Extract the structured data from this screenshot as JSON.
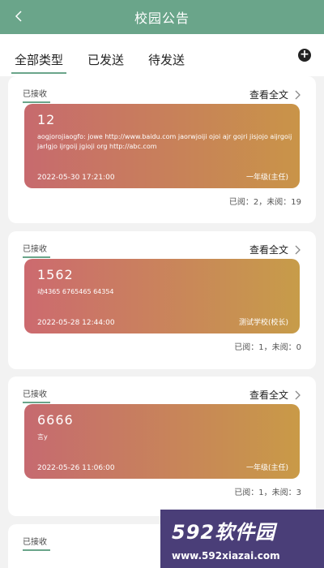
{
  "header": {
    "title": "校园公告"
  },
  "tabs": [
    {
      "label": "全部类型",
      "active": true
    },
    {
      "label": "已发送",
      "active": false
    },
    {
      "label": "待发送",
      "active": false
    }
  ],
  "add_button": {
    "label": "+"
  },
  "cards": [
    {
      "status": "已接收",
      "view_full": "查看全文",
      "title": "12",
      "body": "aogjorojiaogfo: jowe http://www.baidu.com jaorwjoiji ojoi ajr gojri jisjojo aijrgoij jarlgjo ijrgoij jgioji org http://abc.com",
      "date": "2022-05-30 17:21:00",
      "author": "一年级(主任)",
      "stats": "已阅：2，未阅：19",
      "gradient": [
        "#c76a6e",
        "#c99448"
      ]
    },
    {
      "status": "已接收",
      "view_full": "查看全文",
      "title": "1562",
      "body": "动4365 6765465 64354",
      "date": "2022-05-28 12:44:00",
      "author": "测试学校(校长)",
      "stats": "已阅：1，未阅：0",
      "gradient": [
        "#cc6a6f",
        "#c79c49"
      ]
    },
    {
      "status": "已接收",
      "view_full": "查看全文",
      "title": "6666",
      "body": "言y",
      "date": "2022-05-26 11:06:00",
      "author": "一年级(主任)",
      "stats": "已阅：1，未阅：3",
      "gradient": [
        "#c66a70",
        "#c99a47"
      ]
    },
    {
      "status": "已接收"
    }
  ],
  "watermark": {
    "logo": "592软件园",
    "url": "www.592xiazai.com"
  }
}
